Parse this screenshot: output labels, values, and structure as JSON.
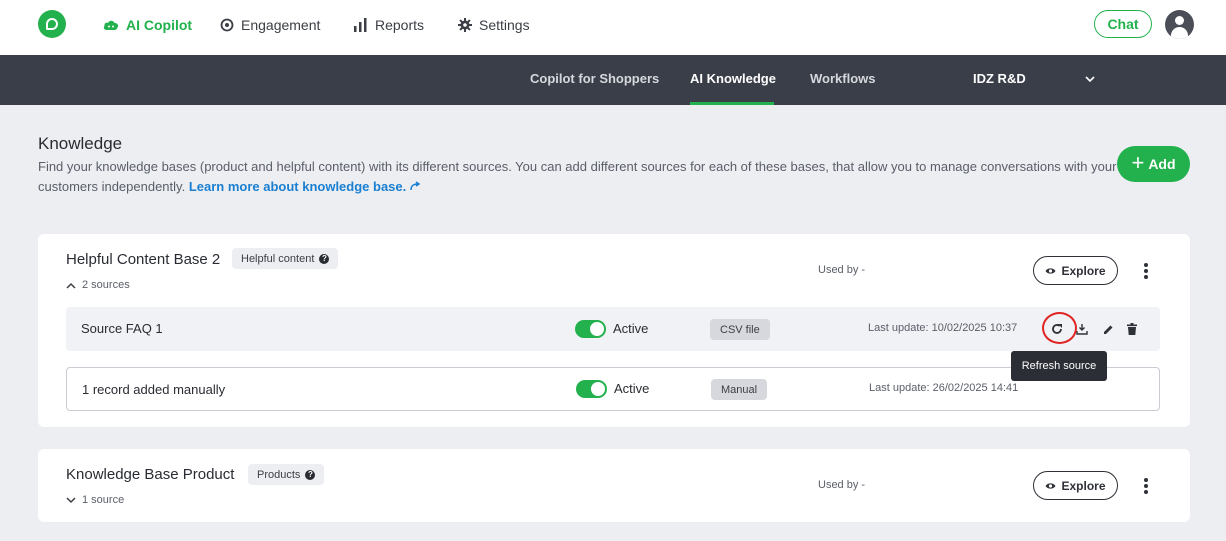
{
  "nav": {
    "items": [
      {
        "label": "AI Copilot",
        "icon": "copilot-cloud-icon"
      },
      {
        "label": "Engagement",
        "icon": "target-icon"
      },
      {
        "label": "Reports",
        "icon": "bar-chart-icon"
      },
      {
        "label": "Settings",
        "icon": "gear-icon"
      }
    ],
    "chat_label": "Chat"
  },
  "subnav": {
    "tabs": [
      {
        "label": "Copilot for Shoppers"
      },
      {
        "label": "AI Knowledge"
      },
      {
        "label": "Workflows"
      }
    ],
    "org": "IDZ R&D"
  },
  "header": {
    "title": "Knowledge",
    "description": "Find your knowledge bases (product and helpful content) with its different sources. You can add different sources for each of these bases, that allow you to manage conversations with your customers independently.",
    "link": "Learn more about knowledge base.",
    "add_label": "Add"
  },
  "knowledge_bases": [
    {
      "title": "Helpful Content Base 2",
      "badge": "Helpful content",
      "sources_label": "2 sources",
      "used_by_label": "Used by",
      "used_by_value": "-",
      "explore_label": "Explore",
      "sources": [
        {
          "name": "Source FAQ 1",
          "status": "Active",
          "type": "CSV file",
          "last_update": "Last update: 10/02/2025 10:37"
        },
        {
          "name": "1 record added manually",
          "status": "Active",
          "type": "Manual",
          "last_update": "Last update: 26/02/2025 14:41"
        }
      ]
    },
    {
      "title": "Knowledge Base Product",
      "badge": "Products",
      "sources_label": "1 source",
      "used_by_label": "Used by",
      "used_by_value": "-",
      "explore_label": "Explore"
    }
  ],
  "tooltip": "Refresh source",
  "colors": {
    "accent": "#23b14d",
    "subnav_bg": "#3a3e48",
    "link": "#1b7fd1",
    "highlight": "#e02424"
  }
}
